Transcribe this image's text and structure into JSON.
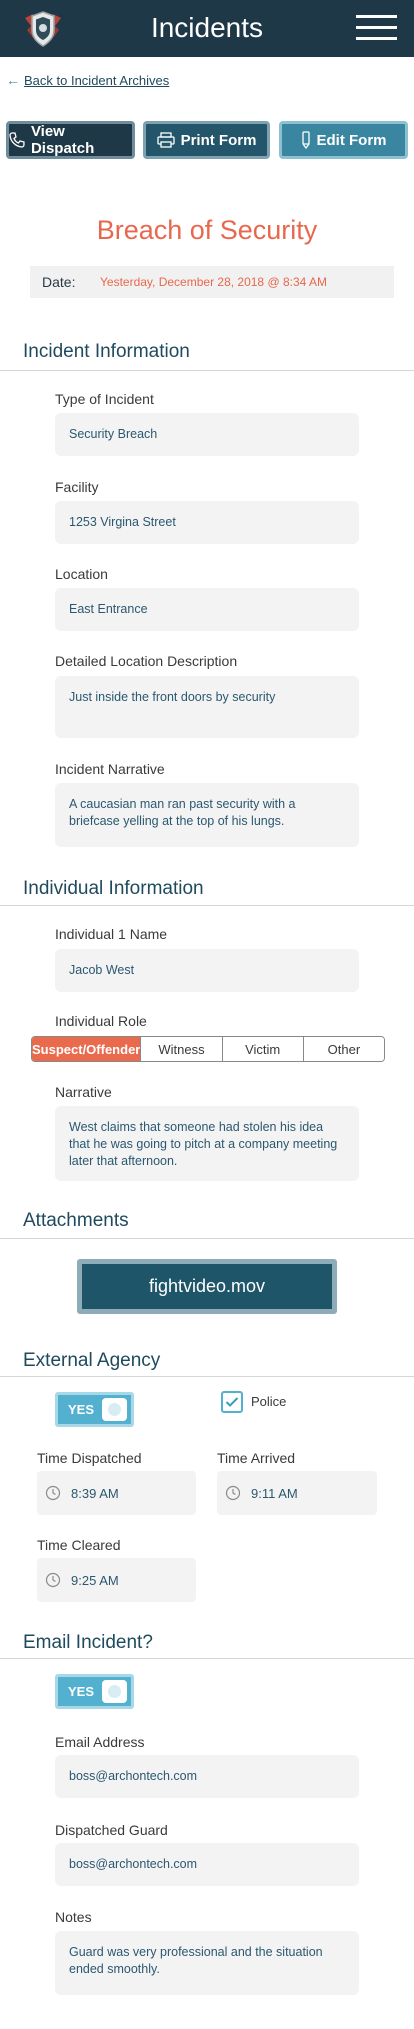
{
  "header": {
    "title": "Incidents",
    "logo_icon": "shield-badge-icon",
    "menu_icon": "hamburger-menu-icon"
  },
  "back_link": {
    "label": "Back to Incident Archives"
  },
  "actions": {
    "view_dispatch": "View Dispatch",
    "print_form": "Print Form",
    "edit_form": "Edit Form"
  },
  "incident": {
    "title": "Breach of Security",
    "date_label": "Date:",
    "date_value": "Yesterday, December 28, 2018 @ 8:34 AM"
  },
  "incident_info": {
    "section_title": "Incident Information",
    "type_label": "Type of Incident",
    "type_value": "Security Breach",
    "facility_label": "Facility",
    "facility_value": "1253 Virgina Street",
    "location_label": "Location",
    "location_value": "East Entrance",
    "detail_label": "Detailed Location Description",
    "detail_value": "Just inside the front doors by security",
    "narrative_label": "Incident Narrative",
    "narrative_value": "A caucasian man ran past security with a briefcase yelling at the top of his lungs."
  },
  "individual_info": {
    "section_title": "Individual Information",
    "name_label": "Individual 1 Name",
    "name_value": "Jacob West",
    "role_label": "Individual Role",
    "roles": [
      "Suspect/Offender",
      "Witness",
      "Victim",
      "Other"
    ],
    "selected_role": "Suspect/Offender",
    "narrative_label": "Narrative",
    "narrative_value": "West claims that someone had stolen his idea that he was going to pitch at a company meeting later that afternoon."
  },
  "attachments": {
    "section_title": "Attachments",
    "file_name": "fightvideo.mov"
  },
  "external_agency": {
    "section_title": "External Agency",
    "toggle_label": "YES",
    "toggle_on": true,
    "police_label": "Police",
    "police_checked": true,
    "time_dispatched_label": "Time Dispatched",
    "time_dispatched": "8:39 AM",
    "time_arrived_label": "Time Arrived",
    "time_arrived": "9:11 AM",
    "time_cleared_label": "Time Cleared",
    "time_cleared": "9:25 AM"
  },
  "email_incident": {
    "section_title": "Email Incident?",
    "toggle_label": "YES",
    "toggle_on": true,
    "email_label": "Email Address",
    "email_value": "boss@archontech.com",
    "guard_label": "Dispatched Guard",
    "guard_value": "boss@archontech.com",
    "notes_label": "Notes",
    "notes_value": "Guard was very professional and the situation ended smoothly."
  },
  "colors": {
    "header_bg": "#1f3847",
    "accent_orange": "#e8684d",
    "accent_teal": "#53b0cf",
    "text_blue": "#2b5870"
  }
}
